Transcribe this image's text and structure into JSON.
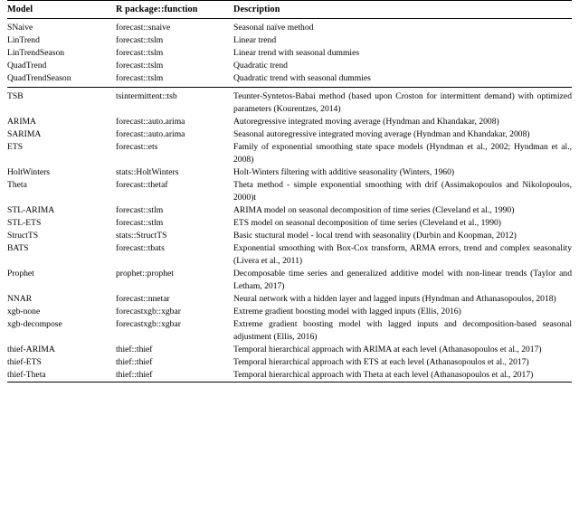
{
  "table": {
    "headers": {
      "model": "Model",
      "fn": "R package::function",
      "desc": "Description"
    },
    "groups": [
      {
        "rows": [
          {
            "model": "SNaive",
            "fn": "forecast::snaive",
            "desc": "Seasonal naïve method"
          },
          {
            "model": "LinTrend",
            "fn": "forecast::tslm",
            "desc": "Linear trend"
          },
          {
            "model": "LinTrendSeason",
            "fn": "forecast::tslm",
            "desc": "Linear trend with seasonal dummies"
          },
          {
            "model": "QuadTrend",
            "fn": "forecast::tslm",
            "desc": "Quadratic trend"
          },
          {
            "model": "QuadTrendSeason",
            "fn": "forecast::tslm",
            "desc": "Quadratic trend with seasonal dummies"
          }
        ]
      },
      {
        "rows": [
          {
            "model": "TSB",
            "fn": "tsintermittent::tsb",
            "desc": "Teunter-Syntetos-Babai method (based upon Croston for intermittent demand) with optimized parameters (Kourentzes, 2014)"
          },
          {
            "model": "ARIMA",
            "fn": "forecast::auto.arima",
            "desc": "Autoregressive integrated moving average (Hyndman and Khandakar, 2008)"
          },
          {
            "model": "SARIMA",
            "fn": "forecast::auto.arima",
            "desc": "Seasonal autoregressive integrated moving average (Hyndman and Khandakar, 2008)"
          },
          {
            "model": "ETS",
            "fn": "forecast::ets",
            "desc": "Family of exponential smoothing state space models (Hyndman et al., 2002; Hyndman et al., 2008)"
          },
          {
            "model": "HoltWinters",
            "fn": "stats::HoltWinters",
            "desc": "Holt-Winters filtering with additive seasonality (Winters, 1960)"
          },
          {
            "model": "Theta",
            "fn": "forecast::thetaf",
            "desc": "Theta method - simple exponential smoothing with drif (Assimakopoulos and Nikolopoulos, 2000)t"
          },
          {
            "model": "STL-ARIMA",
            "fn": "forecast::stlm",
            "desc": "ARIMA model on seasonal decomposition of time series (Cleveland et al., 1990)"
          },
          {
            "model": "STL-ETS",
            "fn": "forecast::stlm",
            "desc": "ETS model on seasonal decomposition of time series (Cleveland et al., 1990)"
          },
          {
            "model": "StructTS",
            "fn": "stats::StructTS",
            "desc": "Basic stuctural model - local trend with seasonality (Durbin and Koopman, 2012)"
          },
          {
            "model": "BATS",
            "fn": "forecast::tbats",
            "desc": "Exponential smoothing with Box-Cox transform, ARMA errors, trend and complex seasonality (Livera et al., 2011)"
          },
          {
            "model": "Prophet",
            "fn": "prophet::prophet",
            "desc": "Decomposable time series and generalized additive model with non-linear trends (Taylor and Letham, 2017)"
          },
          {
            "model": "NNAR",
            "fn": "forecast::nnetar",
            "desc": "Neural network with a hidden layer and lagged inputs (Hyndman and Athanasopoulos, 2018)"
          },
          {
            "model": "xgb-none",
            "fn": "forecastxgb::xgbar",
            "desc": "Extreme gradient boosting model with lagged inputs (Ellis, 2016)"
          },
          {
            "model": "xgb-decompose",
            "fn": "forecastxgb::xgbar",
            "desc": "Extreme gradient boosting model with lagged inputs and decomposition-based seasonal adjustment (Ellis, 2016)"
          },
          {
            "model": "thief-ARIMA",
            "fn": "thief::thief",
            "desc": "Temporal hierarchical approach with ARIMA at each level (Athanasopoulos et al., 2017)"
          },
          {
            "model": "thief-ETS",
            "fn": "thief::thief",
            "desc": "Temporal hierarchical approach with ETS at each level (Athanasopoulos et al., 2017)"
          },
          {
            "model": "thief-Theta",
            "fn": "thief::thief",
            "desc": "Temporal hierarchical approach with Theta at each level (Athanasopoulos et al., 2017)"
          }
        ]
      }
    ]
  }
}
